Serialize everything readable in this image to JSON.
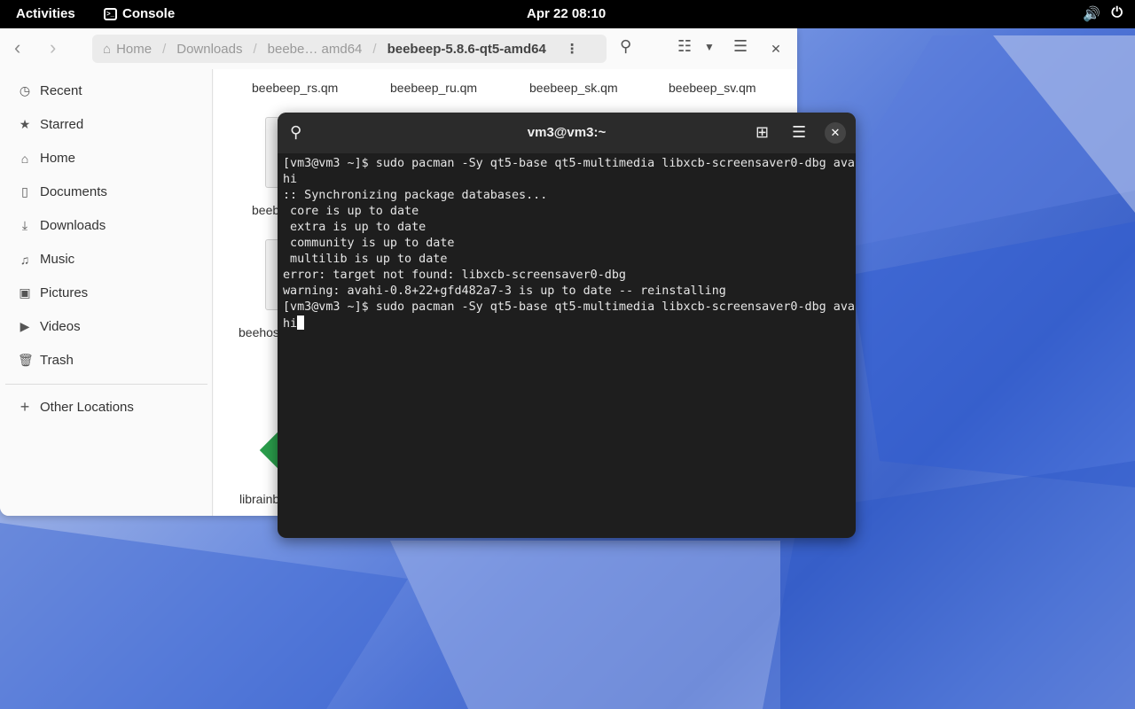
{
  "topbar": {
    "activities": "Activities",
    "app_name": "Console",
    "clock": "Apr 22  08:10"
  },
  "files": {
    "path": [
      "Home",
      "Downloads",
      "beebe… amd64",
      "beebeep-5.8.6-qt5-amd64"
    ],
    "sidebar": [
      {
        "label": "Recent",
        "icon": "clock-icon"
      },
      {
        "label": "Starred",
        "icon": "star-icon"
      },
      {
        "label": "Home",
        "icon": "home-icon"
      },
      {
        "label": "Documents",
        "icon": "document-icon"
      },
      {
        "label": "Downloads",
        "icon": "download-icon"
      },
      {
        "label": "Music",
        "icon": "music-icon"
      },
      {
        "label": "Pictures",
        "icon": "picture-icon"
      },
      {
        "label": "Videos",
        "icon": "video-icon"
      },
      {
        "label": "Trash",
        "icon": "trash-icon"
      }
    ],
    "other_locations": "Other Locations",
    "grid_files": [
      "beebeep_rs.qm",
      "beebeep_ru.qm",
      "beebeep_sk.qm",
      "beebeep_sv.qm",
      "beeb",
      "beehos",
      "librainb"
    ]
  },
  "terminal": {
    "title": "vm3@vm3:~",
    "lines": [
      "[vm3@vm3 ~]$ sudo pacman -Sy qt5-base qt5-multimedia libxcb-screensaver0-dbg ava",
      "hi",
      ":: Synchronizing package databases...",
      " core is up to date",
      " extra is up to date",
      " community is up to date",
      " multilib is up to date",
      "error: target not found: libxcb-screensaver0-dbg",
      "warning: avahi-0.8+22+gfd482a7-3 is up to date -- reinstalling",
      "[vm3@vm3 ~]$ sudo pacman -Sy qt5-base qt5-multimedia libxcb-screensaver0-dbg ava"
    ],
    "input_line": "hi"
  }
}
